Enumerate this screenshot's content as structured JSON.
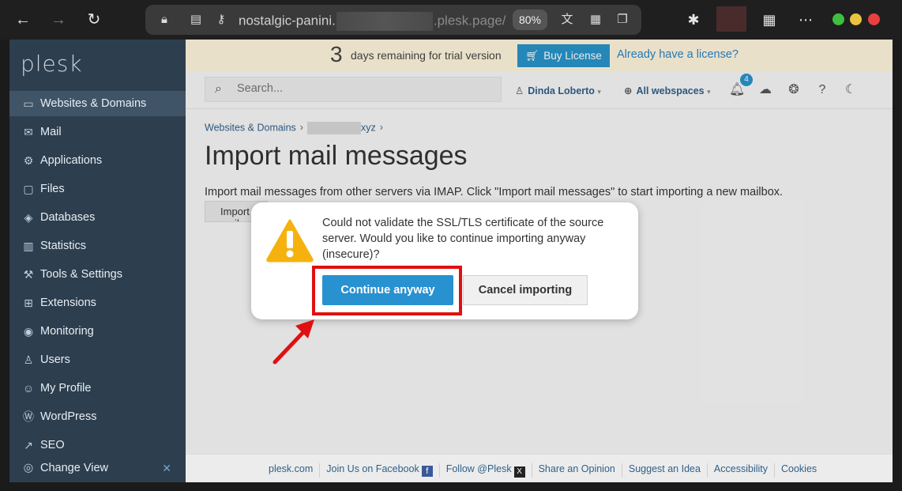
{
  "browser": {
    "url_prefix": "nostalgic-panini.",
    "url_suffix": ".plesk.page/",
    "zoom": "80%"
  },
  "sidebar": {
    "logo": "plesk",
    "items": [
      {
        "label": "Websites & Domains",
        "icon": "monitor-icon",
        "glyph": "▭"
      },
      {
        "label": "Mail",
        "icon": "mail-icon",
        "glyph": "✉"
      },
      {
        "label": "Applications",
        "icon": "gear-icon",
        "glyph": "⚙"
      },
      {
        "label": "Files",
        "icon": "folder-icon",
        "glyph": "▢"
      },
      {
        "label": "Databases",
        "icon": "database-icon",
        "glyph": "◈"
      },
      {
        "label": "Statistics",
        "icon": "bar-chart-icon",
        "glyph": "▥"
      },
      {
        "label": "Tools & Settings",
        "icon": "tools-icon",
        "glyph": "⚒"
      },
      {
        "label": "Extensions",
        "icon": "extensions-icon",
        "glyph": "⊞"
      },
      {
        "label": "Monitoring",
        "icon": "monitoring-icon",
        "glyph": "◉"
      },
      {
        "label": "Users",
        "icon": "user-icon",
        "glyph": "♙"
      },
      {
        "label": "My Profile",
        "icon": "profile-icon",
        "glyph": "☺"
      },
      {
        "label": "WordPress",
        "icon": "wordpress-icon",
        "glyph": "Ⓦ"
      },
      {
        "label": "SEO",
        "icon": "seo-icon",
        "glyph": "↗"
      }
    ],
    "change_view": "Change View"
  },
  "trial_banner": {
    "days": "3",
    "text": "days remaining for trial version",
    "buy_label": "Buy License",
    "already_label": "Already have a license?"
  },
  "header": {
    "search_placeholder": "Search...",
    "user": "Dinda Loberto",
    "webspaces": "All webspaces",
    "notification_count": "4"
  },
  "content": {
    "breadcrumb_root": "Websites & Domains",
    "breadcrumb_domain_suffix": "xyz",
    "title": "Import mail messages",
    "description": "Import mail messages from other servers via IMAP. Click \"Import mail messages\" to start importing a new mailbox.",
    "import_button": "Import mail messages"
  },
  "dialog": {
    "message": "Could not validate the SSL/TLS certificate of the source server. Would you like to continue importing anyway (insecure)?",
    "continue_label": "Continue anyway",
    "cancel_label": "Cancel importing"
  },
  "footer": {
    "links": [
      "plesk.com",
      "Join Us on Facebook",
      "Follow @Plesk",
      "Share an Opinion",
      "Suggest an Idea",
      "Accessibility",
      "Cookies"
    ]
  },
  "colors": {
    "accent": "#2891d0",
    "sidebar": "#2d3e4e",
    "highlight": "#e01010"
  }
}
